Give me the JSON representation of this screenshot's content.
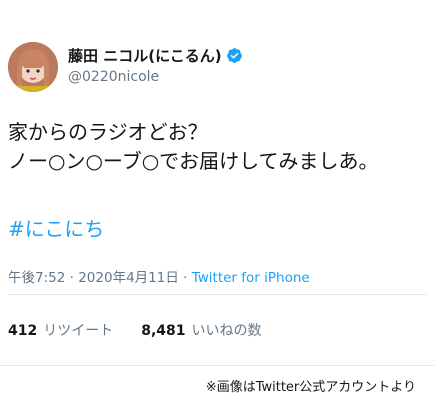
{
  "tweet": {
    "display_name": "藤田 ニコル(にこるん)",
    "handle": "@0220nicole",
    "body_line1": "家からのラジオどお？",
    "body_line2": "ノー○ン○ーブ○でお届けしてみましあ。",
    "hashtag": "#にこにち",
    "time": "午後7:52",
    "date": "2020年4月11日",
    "separator": "·",
    "source": "Twitter for iPhone",
    "retweets_count": "412",
    "retweets_label": "リツイート",
    "likes_count": "8,481",
    "likes_label": "いいねの数"
  },
  "caption": "※画像はTwitter公式アカウントより",
  "colors": {
    "link": "#1da1f2",
    "muted": "#657786",
    "text": "#14171a",
    "verified": "#1da1f2"
  },
  "icons": {
    "verified": "verified-badge-icon"
  }
}
